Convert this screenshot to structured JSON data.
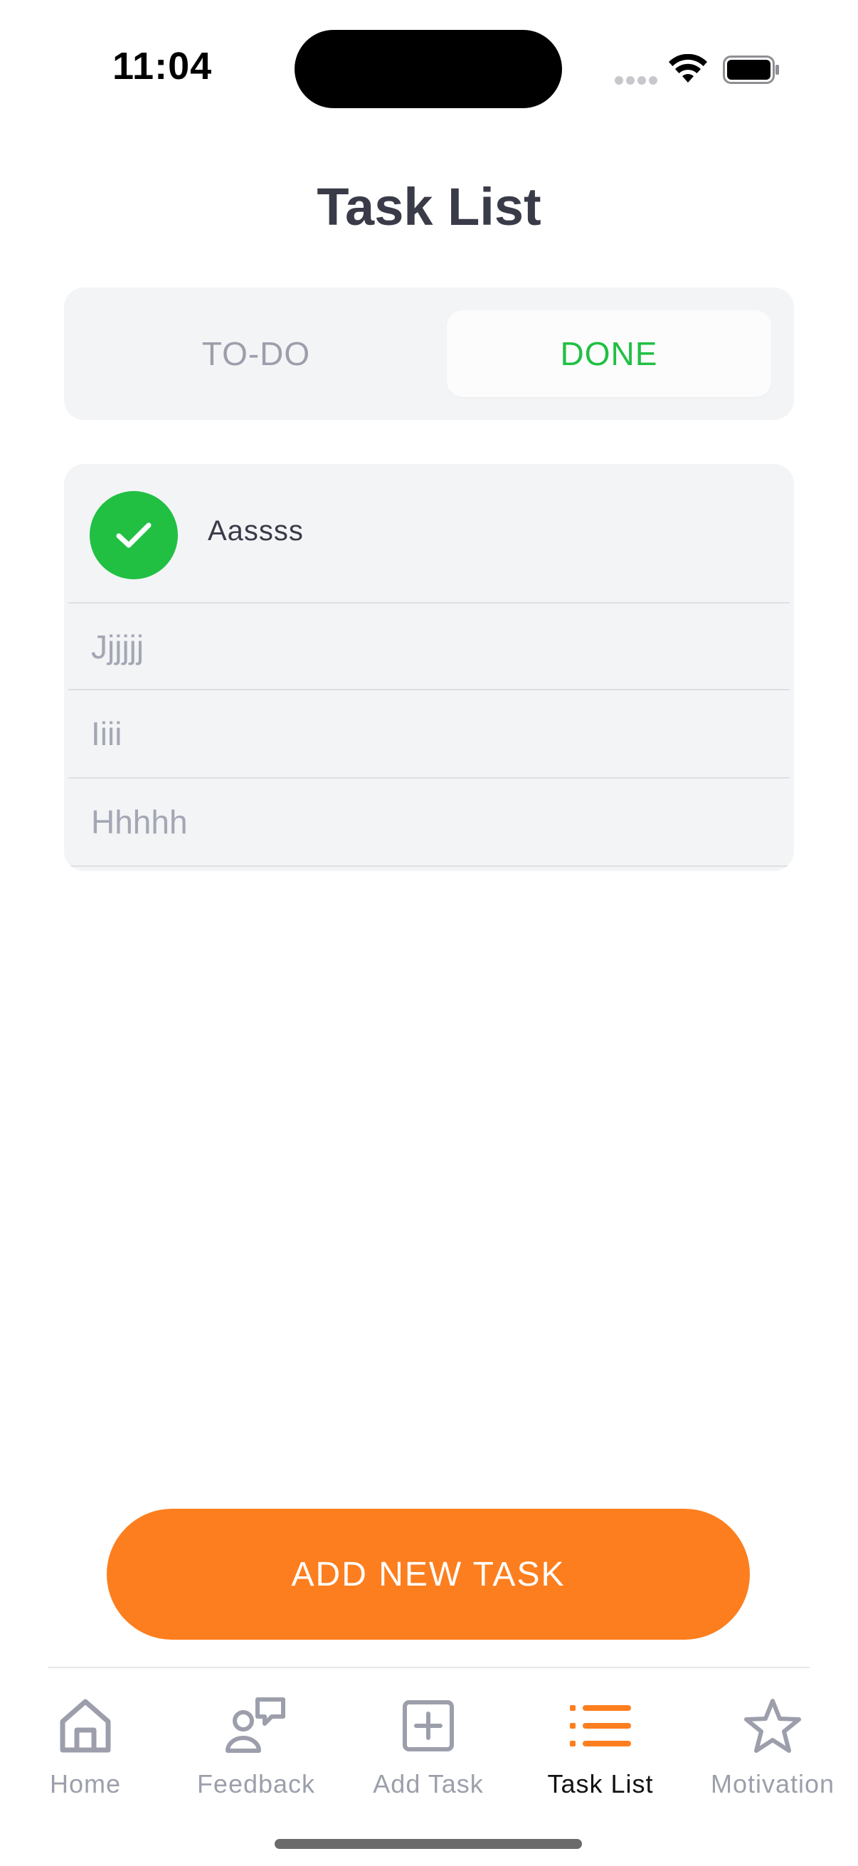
{
  "status_bar": {
    "time": "11:04"
  },
  "header": {
    "title": "Task List"
  },
  "segmented_control": {
    "todo_label": "TO-DO",
    "done_label": "DONE",
    "selected": "DONE",
    "selected_color": "#21c043"
  },
  "tasks": [
    {
      "label": "Aassss",
      "completed": true
    },
    {
      "label": "Jjjjjj",
      "completed": false
    },
    {
      "label": "Iiii",
      "completed": false
    },
    {
      "label": "Hhhhh",
      "completed": false
    }
  ],
  "actions": {
    "add_button_label": "ADD NEW TASK",
    "accent_color": "#fd7e1e"
  },
  "tab_bar": {
    "items": [
      {
        "label": "Home",
        "icon": "home-icon",
        "active": false
      },
      {
        "label": "Feedback",
        "icon": "feedback-icon",
        "active": false
      },
      {
        "label": "Add Task",
        "icon": "add-square-icon",
        "active": false
      },
      {
        "label": "Task List",
        "icon": "list-icon",
        "active": true
      },
      {
        "label": "Motivation",
        "icon": "star-icon",
        "active": false
      }
    ]
  }
}
